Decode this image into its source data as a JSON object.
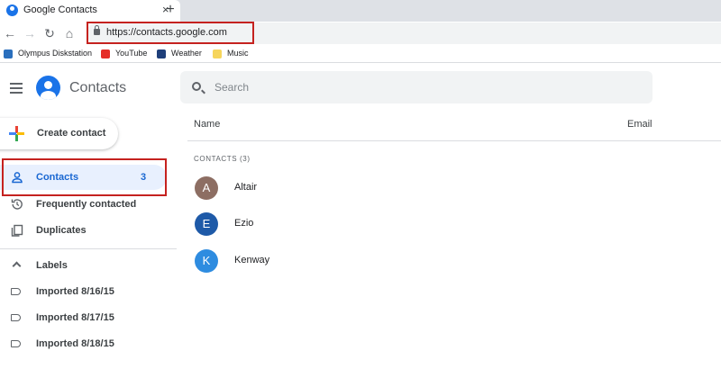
{
  "browser": {
    "tab_title": "Google Contacts",
    "tab_close": "×",
    "new_tab": "+",
    "url": "https://contacts.google.com",
    "bookmarks": [
      "Olympus Diskstation",
      "YouTube",
      "Weather",
      "Music"
    ]
  },
  "app": {
    "title": "Contacts",
    "search_placeholder": "Search",
    "create_label": "Create contact",
    "nav": [
      {
        "label": "Contacts",
        "count": "3"
      },
      {
        "label": "Frequently contacted"
      },
      {
        "label": "Duplicates"
      }
    ],
    "labels_header": "Labels",
    "labels": [
      "Imported 8/16/15",
      "Imported 8/17/15",
      "Imported 8/18/15"
    ]
  },
  "list": {
    "col_name": "Name",
    "col_email": "Email",
    "section": "CONTACTS (3)",
    "contacts": [
      {
        "initial": "A",
        "name": "Altair",
        "color": "#8d6e63"
      },
      {
        "initial": "E",
        "name": "Ezio",
        "color": "#1e5aa8"
      },
      {
        "initial": "K",
        "name": "Kenway",
        "color": "#2e8ce0"
      }
    ]
  },
  "colors": {
    "highlight": "#c5221f",
    "accent": "#1a73e8"
  }
}
